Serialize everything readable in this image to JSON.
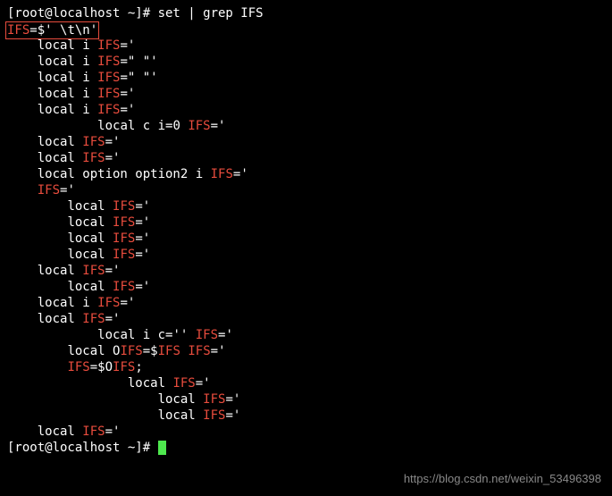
{
  "prompt1": "[root@localhost ~]# set | grep IFS",
  "boxed_line": {
    "p1": "IFS",
    "p2": "=$' \\t\\n'"
  },
  "lines": [
    {
      "indent": "    ",
      "segments": [
        {
          "t": "local i ",
          "c": "white"
        },
        {
          "t": "IFS",
          "c": "red"
        },
        {
          "t": "='",
          "c": "white"
        }
      ]
    },
    {
      "indent": "    ",
      "segments": [
        {
          "t": "local i ",
          "c": "white"
        },
        {
          "t": "IFS",
          "c": "red"
        },
        {
          "t": "=\" \"'",
          "c": "white"
        }
      ]
    },
    {
      "indent": "    ",
      "segments": [
        {
          "t": "local i ",
          "c": "white"
        },
        {
          "t": "IFS",
          "c": "red"
        },
        {
          "t": "=\" \"'",
          "c": "white"
        }
      ]
    },
    {
      "indent": "    ",
      "segments": [
        {
          "t": "local i ",
          "c": "white"
        },
        {
          "t": "IFS",
          "c": "red"
        },
        {
          "t": "='",
          "c": "white"
        }
      ]
    },
    {
      "indent": "    ",
      "segments": [
        {
          "t": "local i ",
          "c": "white"
        },
        {
          "t": "IFS",
          "c": "red"
        },
        {
          "t": "='",
          "c": "white"
        }
      ]
    },
    {
      "indent": "            ",
      "segments": [
        {
          "t": "local c i=0 ",
          "c": "white"
        },
        {
          "t": "IFS",
          "c": "red"
        },
        {
          "t": "='",
          "c": "white"
        }
      ]
    },
    {
      "indent": "    ",
      "segments": [
        {
          "t": "local ",
          "c": "white"
        },
        {
          "t": "IFS",
          "c": "red"
        },
        {
          "t": "='",
          "c": "white"
        }
      ]
    },
    {
      "indent": "    ",
      "segments": [
        {
          "t": "local ",
          "c": "white"
        },
        {
          "t": "IFS",
          "c": "red"
        },
        {
          "t": "='",
          "c": "white"
        }
      ]
    },
    {
      "indent": "    ",
      "segments": [
        {
          "t": "local option option2 i ",
          "c": "white"
        },
        {
          "t": "IFS",
          "c": "red"
        },
        {
          "t": "='",
          "c": "white"
        }
      ]
    },
    {
      "indent": "    ",
      "segments": [
        {
          "t": "IFS",
          "c": "red"
        },
        {
          "t": "='",
          "c": "white"
        }
      ]
    },
    {
      "indent": "        ",
      "segments": [
        {
          "t": "local ",
          "c": "white"
        },
        {
          "t": "IFS",
          "c": "red"
        },
        {
          "t": "='",
          "c": "white"
        }
      ]
    },
    {
      "indent": "        ",
      "segments": [
        {
          "t": "local ",
          "c": "white"
        },
        {
          "t": "IFS",
          "c": "red"
        },
        {
          "t": "='",
          "c": "white"
        }
      ]
    },
    {
      "indent": "        ",
      "segments": [
        {
          "t": "local ",
          "c": "white"
        },
        {
          "t": "IFS",
          "c": "red"
        },
        {
          "t": "='",
          "c": "white"
        }
      ]
    },
    {
      "indent": "        ",
      "segments": [
        {
          "t": "local ",
          "c": "white"
        },
        {
          "t": "IFS",
          "c": "red"
        },
        {
          "t": "='",
          "c": "white"
        }
      ]
    },
    {
      "indent": "    ",
      "segments": [
        {
          "t": "local ",
          "c": "white"
        },
        {
          "t": "IFS",
          "c": "red"
        },
        {
          "t": "='",
          "c": "white"
        }
      ]
    },
    {
      "indent": "        ",
      "segments": [
        {
          "t": "local ",
          "c": "white"
        },
        {
          "t": "IFS",
          "c": "red"
        },
        {
          "t": "='",
          "c": "white"
        }
      ]
    },
    {
      "indent": "    ",
      "segments": [
        {
          "t": "local i ",
          "c": "white"
        },
        {
          "t": "IFS",
          "c": "red"
        },
        {
          "t": "='",
          "c": "white"
        }
      ]
    },
    {
      "indent": "    ",
      "segments": [
        {
          "t": "local ",
          "c": "white"
        },
        {
          "t": "IFS",
          "c": "red"
        },
        {
          "t": "='",
          "c": "white"
        }
      ]
    },
    {
      "indent": "            ",
      "segments": [
        {
          "t": "local i c='' ",
          "c": "white"
        },
        {
          "t": "IFS",
          "c": "red"
        },
        {
          "t": "='",
          "c": "white"
        }
      ]
    },
    {
      "indent": "        ",
      "segments": [
        {
          "t": "local O",
          "c": "white"
        },
        {
          "t": "IFS",
          "c": "red"
        },
        {
          "t": "=$",
          "c": "white"
        },
        {
          "t": "IFS",
          "c": "red"
        },
        {
          "t": " ",
          "c": "white"
        },
        {
          "t": "IFS",
          "c": "red"
        },
        {
          "t": "='",
          "c": "white"
        }
      ]
    },
    {
      "indent": "        ",
      "segments": [
        {
          "t": "IFS",
          "c": "red"
        },
        {
          "t": "=$O",
          "c": "white"
        },
        {
          "t": "IFS",
          "c": "red"
        },
        {
          "t": ";",
          "c": "white"
        }
      ]
    },
    {
      "indent": "                ",
      "segments": [
        {
          "t": "local ",
          "c": "white"
        },
        {
          "t": "IFS",
          "c": "red"
        },
        {
          "t": "='",
          "c": "white"
        }
      ]
    },
    {
      "indent": "                    ",
      "segments": [
        {
          "t": "local ",
          "c": "white"
        },
        {
          "t": "IFS",
          "c": "red"
        },
        {
          "t": "='",
          "c": "white"
        }
      ]
    },
    {
      "indent": "                    ",
      "segments": [
        {
          "t": "local ",
          "c": "white"
        },
        {
          "t": "IFS",
          "c": "red"
        },
        {
          "t": "='",
          "c": "white"
        }
      ]
    },
    {
      "indent": "    ",
      "segments": [
        {
          "t": "local ",
          "c": "white"
        },
        {
          "t": "IFS",
          "c": "red"
        },
        {
          "t": "='",
          "c": "white"
        }
      ]
    }
  ],
  "prompt2": "[root@localhost ~]# ",
  "watermark": "https://blog.csdn.net/weixin_53496398"
}
